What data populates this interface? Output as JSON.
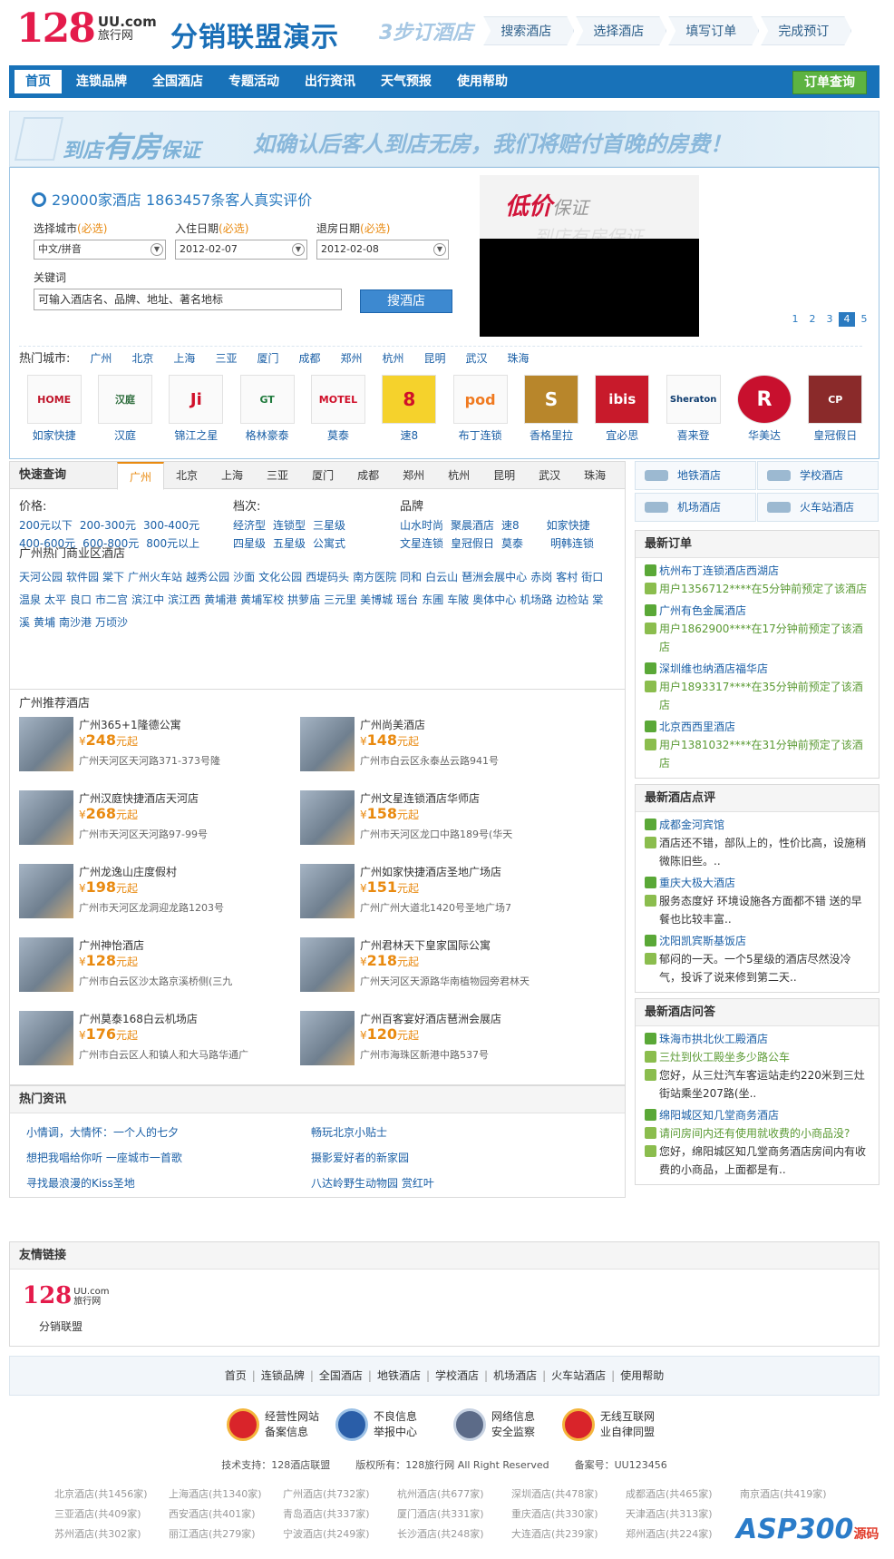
{
  "header": {
    "logo_num": "128",
    "logo_uu": "UU.com",
    "logo_sub": "旅行网",
    "site_title": "分销联盟演示",
    "steps_lead": "3步订酒店",
    "steps": [
      "搜索酒店",
      "选择酒店",
      "填写订单",
      "完成预订"
    ]
  },
  "nav": {
    "items": [
      "首页",
      "连锁品牌",
      "全国酒店",
      "专题活动",
      "出行资讯",
      "天气预报",
      "使用帮助"
    ],
    "order_btn": "订单查询"
  },
  "banner": {
    "text1_a": "到店",
    "text1_b": "有房",
    "text1_c": "保证",
    "text2": "如确认后客人到店无房，我们将赔付首晚的房费！"
  },
  "search": {
    "count": "29000家酒店  1863457条客人真实评价",
    "city_label": "选择城市",
    "city_req": "(必选)",
    "city_value": "中文/拼音",
    "checkin_label": "入住日期",
    "checkin_req": "(必选)",
    "checkin_value": "2012-02-07",
    "checkout_label": "退房日期",
    "checkout_req": "(必选)",
    "checkout_value": "2012-02-08",
    "kw_label": "关键词",
    "kw_placeholder": "可输入酒店名、品牌、地址、著名地标",
    "btn": "搜酒店",
    "promo_a": "低价",
    "promo_b": "保证",
    "promo_c": "到店有房保证",
    "pages": [
      "1",
      "2",
      "3",
      "4",
      "5"
    ],
    "hot_label": "热门城市:",
    "hot_cities": [
      "广州",
      "北京",
      "上海",
      "三亚",
      "厦门",
      "成都",
      "郑州",
      "杭州",
      "昆明",
      "武汉",
      "珠海"
    ]
  },
  "brands": [
    {
      "name": "如家快捷",
      "logo": "HOME"
    },
    {
      "name": "汉庭",
      "logo": "汉庭"
    },
    {
      "name": "锦江之星",
      "logo": "Ji"
    },
    {
      "name": "格林豪泰",
      "logo": "GT"
    },
    {
      "name": "莫泰",
      "logo": "MOTEL"
    },
    {
      "name": "速8",
      "logo": "8"
    },
    {
      "name": "布丁连锁",
      "logo": "pod"
    },
    {
      "name": "香格里拉",
      "logo": "S"
    },
    {
      "name": "宜必思",
      "logo": "ibis"
    },
    {
      "name": "喜来登",
      "logo": "Sheraton"
    },
    {
      "name": "华美达",
      "logo": "R"
    },
    {
      "name": "皇冠假日",
      "logo": "CP"
    }
  ],
  "quick": {
    "title": "快速查询",
    "tabs": [
      "广州",
      "北京",
      "上海",
      "三亚",
      "厦门",
      "成都",
      "郑州",
      "杭州",
      "昆明",
      "武汉",
      "珠海"
    ],
    "price_label": "价格:",
    "price": [
      "200元以下",
      "200-300元",
      "300-400元",
      "400-600元",
      "600-800元",
      "800元以上"
    ],
    "level_label": "档次:",
    "level": [
      "经济型",
      "连锁型",
      "三星级",
      "四星级",
      "五星级",
      "公寓式"
    ],
    "brand_label": "品牌",
    "brand": [
      "山水时尚",
      "聚晨酒店",
      "速8",
      "如家快捷",
      "文星连锁",
      "皇冠假日",
      "莫泰",
      "明韩连锁"
    ],
    "biz_title": "广州热门商业区酒店",
    "biz": [
      "天河公园",
      "软件园",
      "棠下",
      "广州火车站",
      "越秀公园",
      "沙面",
      "文化公园",
      "西堤码头",
      "南方医院",
      "同和",
      "白云山",
      "琶洲会展中心",
      "赤岗",
      "客村",
      "街口",
      "温泉",
      "太平",
      "良口",
      "市二宫",
      "滨江中",
      "滨江西",
      "黄埔港",
      "黄埔军校",
      "拱萝庙",
      "三元里",
      "美博城",
      "瑶台",
      "东圃",
      "车陂",
      "奥体中心",
      "机场路",
      "边检站",
      "棠溪",
      "黄埔",
      "南沙港",
      "万顷沙"
    ]
  },
  "rec": {
    "title": "广州推荐酒店",
    "currency": "¥",
    "suffix": "元起",
    "hotels": [
      {
        "name": "广州365+1隆德公寓",
        "price": "248",
        "addr": "广州天河区天河路371-373号隆"
      },
      {
        "name": "广州尚美酒店",
        "price": "148",
        "addr": "广州市白云区永泰丛云路941号"
      },
      {
        "name": "广州汉庭快捷酒店天河店",
        "price": "268",
        "addr": "广州市天河区天河路97-99号"
      },
      {
        "name": "广州文星连锁酒店华师店",
        "price": "158",
        "addr": "广州市天河区龙口中路189号(华天"
      },
      {
        "name": "广州龙逸山庄度假村",
        "price": "198",
        "addr": "广州市天河区龙洞迎龙路1203号"
      },
      {
        "name": "广州如家快捷酒店圣地广场店",
        "price": "151",
        "addr": "广州广州大道北1420号圣地广场7"
      },
      {
        "name": "广州神怡酒店",
        "price": "128",
        "addr": "广州市白云区沙太路京溪桥侧(三九"
      },
      {
        "name": "广州君林天下皇家国际公寓",
        "price": "218",
        "addr": "广州天河区天源路华南植物园旁君林天"
      },
      {
        "name": "广州莫泰168白云机场店",
        "price": "176",
        "addr": "广州市白云区人和镇人和大马路华通广"
      },
      {
        "name": "广州百客宴好酒店琶洲会展店",
        "price": "120",
        "addr": "广州市海珠区新港中路537号"
      }
    ]
  },
  "news": {
    "title": "热门资讯",
    "items": [
      "小情调，大情怀：一个人的七夕",
      "畅玩北京小贴士",
      "想把我唱给你听  一座城市一首歌",
      "摄影爱好者的新家园",
      "寻找最浪漫的Kiss圣地",
      "八达岭野生动物园 赏红叶"
    ]
  },
  "right": {
    "quick": [
      "地铁酒店",
      "学校酒店",
      "机场酒店",
      "火车站酒店"
    ],
    "orders_title": "最新订单",
    "orders": [
      {
        "hotel": "杭州布丁连锁酒店西湖店",
        "text": "用户1356712****在5分钟前预定了该酒店"
      },
      {
        "hotel": "广州有色金属酒店",
        "text": "用户1862900****在17分钟前预定了该酒店"
      },
      {
        "hotel": "深圳维也纳酒店福华店",
        "text": "用户1893317****在35分钟前预定了该酒店"
      },
      {
        "hotel": "北京西西里酒店",
        "text": "用户1381032****在31分钟前预定了该酒店"
      }
    ],
    "reviews_title": "最新酒店点评",
    "reviews": [
      {
        "hotel": "成都金河宾馆",
        "text": "酒店还不错，部队上的，性价比高，设施稍微陈旧些。.."
      },
      {
        "hotel": "重庆大极大酒店",
        "text": "服务态度好 环境设施各方面都不错 送的早餐也比较丰富.."
      },
      {
        "hotel": "沈阳凯宾斯基饭店",
        "text": "郁闷的一天。一个5星级的酒店尽然没冷气，投诉了说来修到第二天.."
      }
    ],
    "qa_title": "最新酒店问答",
    "qa": [
      {
        "hotel": "珠海市拱北伙工殿酒店",
        "q": "三灶到伙工殿坐多少路公车",
        "a": "您好，从三灶汽车客运站走约220米到三灶街站乘坐207路(坐.."
      },
      {
        "hotel": "绵阳城区知几堂商务酒店",
        "q": "请问房间内还有使用就收费的小商品没?",
        "a": "您好，绵阳城区知几堂商务酒店房间内有收费的小商品，上面都是有.."
      }
    ]
  },
  "links": {
    "title": "友情链接",
    "logo_num": "128",
    "logo_uu": "UU.com",
    "logo_sub": "旅行网",
    "caption": "分销联盟"
  },
  "footer": {
    "nav": [
      "首页",
      "连锁品牌",
      "全国酒店",
      "地铁酒店",
      "学校酒店",
      "机场酒店",
      "火车站酒店",
      "使用帮助"
    ],
    "certs": [
      {
        "a": "经营性网站",
        "b": "备案信息"
      },
      {
        "a": "不良信息",
        "b": "举报中心"
      },
      {
        "a": "网络信息",
        "b": "安全监察"
      },
      {
        "a": "无线互联网",
        "b": "业自律同盟"
      }
    ],
    "tech": "技术支持：128酒店联盟",
    "copy": "版权所有：128旅行网 All Right Reserved",
    "icp": "备案号：UU123456",
    "cities": [
      [
        "北京酒店(共1456家)",
        "上海酒店(共1340家)",
        "广州酒店(共732家)",
        "杭州酒店(共677家)",
        "深圳酒店(共478家)",
        "成都酒店(共465家)",
        "南京酒店(共419家)"
      ],
      [
        "三亚酒店(共409家)",
        "西安酒店(共401家)",
        "青岛酒店(共337家)",
        "厦门酒店(共331家)",
        "重庆酒店(共330家)",
        "天津酒店(共313家)"
      ],
      [
        "苏州酒店(共302家)",
        "丽江酒店(共279家)",
        "宁波酒店(共249家)",
        "长沙酒店(共248家)",
        "大连酒店(共239家)",
        "郑州酒店(共224家)"
      ]
    ],
    "watermark": "ASP300",
    "watermark_b": "源码"
  }
}
